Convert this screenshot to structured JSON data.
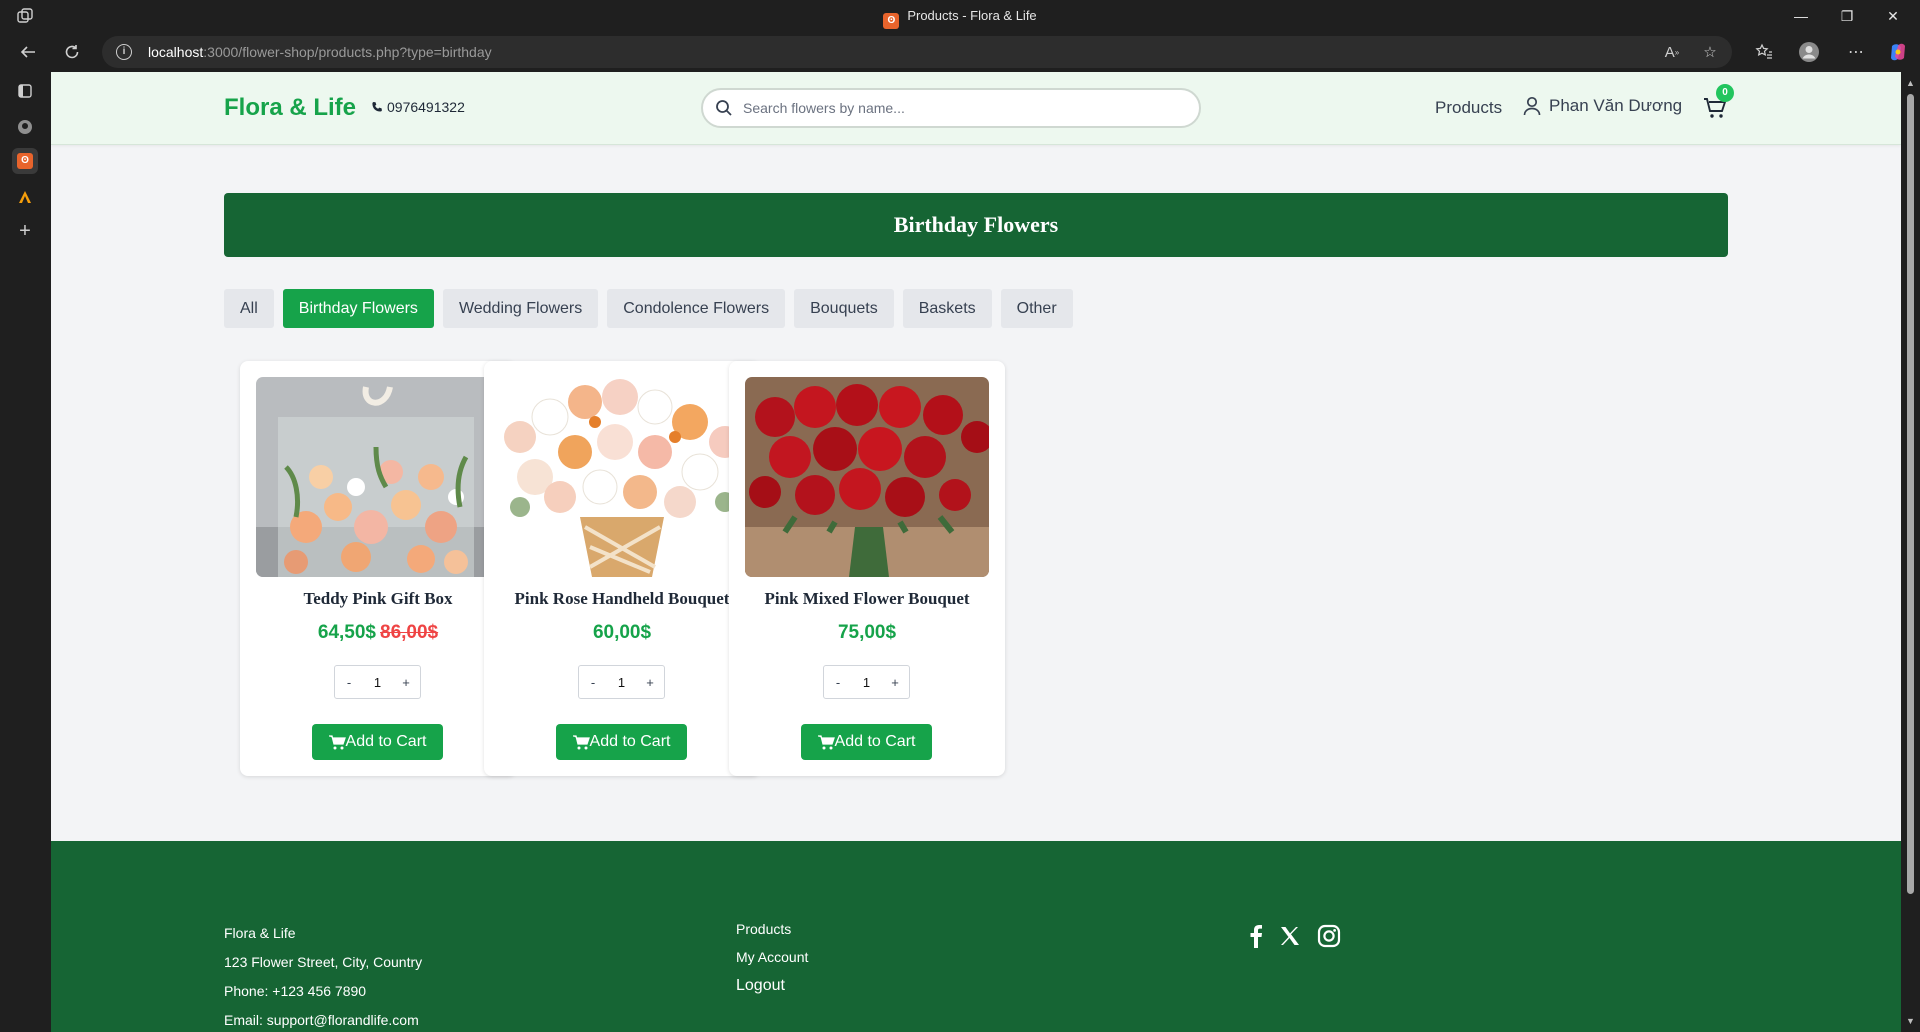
{
  "browser": {
    "tab_title": "Products - Flora & Life",
    "url_host": "localhost",
    "url_rest": ":3000/flower-shop/products.php?type=birthday"
  },
  "header": {
    "logo": "Flora & Life",
    "phone": "0976491322",
    "search_placeholder": "Search flowers by name...",
    "nav_products": "Products",
    "user_name": "Phan Văn Dương",
    "cart_count": "0"
  },
  "banner": {
    "title": "Birthday Flowers"
  },
  "filters": [
    {
      "label": "All",
      "active": false
    },
    {
      "label": "Birthday Flowers",
      "active": true
    },
    {
      "label": "Wedding Flowers",
      "active": false
    },
    {
      "label": "Condolence Flowers",
      "active": false
    },
    {
      "label": "Bouquets",
      "active": false
    },
    {
      "label": "Baskets",
      "active": false
    },
    {
      "label": "Other",
      "active": false
    }
  ],
  "products": [
    {
      "name": "Teddy Pink Gift Box",
      "price": "64,50$",
      "old_price": "86,00$",
      "qty": "1",
      "qty_minus": "-",
      "qty_plus": "+",
      "button": "Add to Cart"
    },
    {
      "name": "Pink Rose Handheld Bouquet",
      "price": "60,00$",
      "old_price": "",
      "qty": "1",
      "qty_minus": "-",
      "qty_plus": "+",
      "button": "Add to Cart"
    },
    {
      "name": "Pink Mixed Flower Bouquet",
      "price": "75,00$",
      "old_price": "",
      "qty": "1",
      "qty_minus": "-",
      "qty_plus": "+",
      "button": "Add to Cart"
    }
  ],
  "footer": {
    "brand": "Flora & Life",
    "address": "123 Flower Street, City, Country",
    "phone": "Phone: +123 456 7890",
    "email": "Email: support@florandlife.com",
    "links": {
      "products": "Products",
      "account": "My Account",
      "logout": "Logout"
    },
    "social_icons": [
      "facebook-icon",
      "x-icon",
      "instagram-icon"
    ]
  },
  "colors": {
    "primary": "#16a34a",
    "dark_green": "#166534",
    "header_bg": "#edf8ef",
    "page_bg": "#f3f4f6",
    "sale_red": "#ef4444"
  }
}
